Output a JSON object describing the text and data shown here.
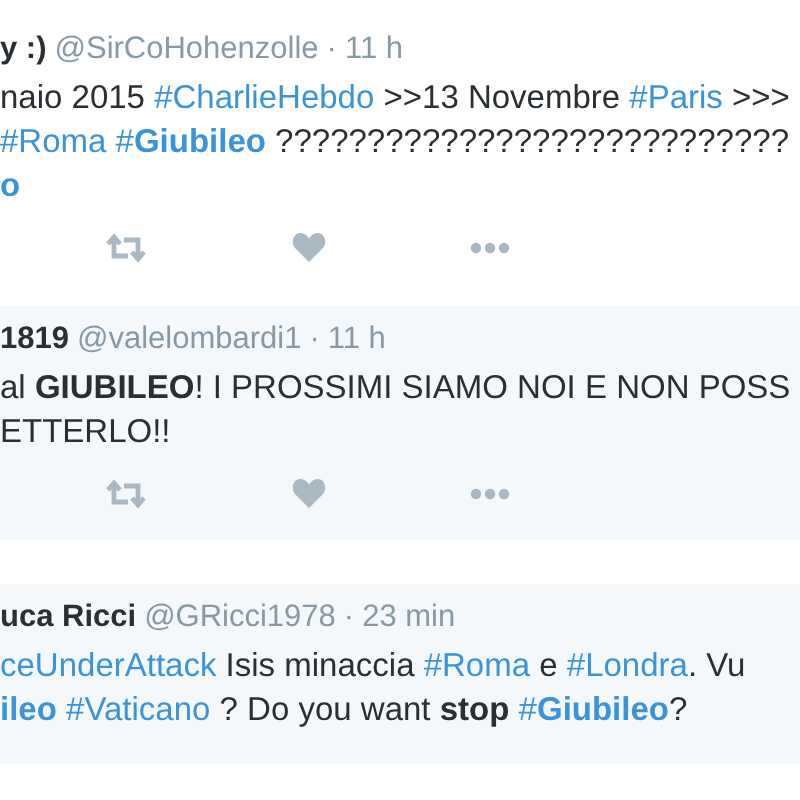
{
  "tweets": [
    {
      "name": "y :)",
      "handle": "@SirCoHohenzolle",
      "separator": "·",
      "time": "11 h",
      "highlighted": false,
      "lines": [
        [
          {
            "text": "naio 2015 ",
            "kind": "text"
          },
          {
            "text": "#CharlieHebdo",
            "kind": "hashtag"
          },
          {
            "text": " >>13 Novembre ",
            "kind": "text"
          },
          {
            "text": "#Paris",
            "kind": "hashtag"
          },
          {
            "text": " >>>",
            "kind": "text"
          }
        ],
        [
          {
            "text": "#Roma ",
            "kind": "hashtag"
          },
          {
            "text": "#**Giubileo**",
            "kind": "hashtag"
          },
          {
            "text": " ????????????????????????????",
            "kind": "text"
          }
        ],
        [
          {
            "text": "**o**",
            "kind": "hashtag"
          }
        ]
      ],
      "actions": true
    },
    {
      "name": "1819",
      "handle": "@valelombardi1",
      "separator": "·",
      "time": "11 h",
      "highlighted": true,
      "lines": [
        [
          {
            "text": "al **GIUBILEO**! I PROSSIMI SIAMO NOI E NON POSS",
            "kind": "text"
          }
        ],
        [
          {
            "text": "ETTERLO!!",
            "kind": "text"
          }
        ]
      ],
      "actions": true
    },
    {
      "name": "uca Ricci",
      "handle": "@GRicci1978",
      "separator": "·",
      "time": "23 min",
      "highlighted": true,
      "lines": [
        [
          {
            "text": "ceUnderAttack",
            "kind": "hashtag"
          },
          {
            "text": " Isis  minaccia ",
            "kind": "text"
          },
          {
            "text": "#Roma",
            "kind": "hashtag"
          },
          {
            "text": " e ",
            "kind": "text"
          },
          {
            "text": "#Londra",
            "kind": "hashtag"
          },
          {
            "text": ". Vu",
            "kind": "text"
          }
        ],
        [
          {
            "text": "**ileo** ",
            "kind": "hashtag"
          },
          {
            "text": "#Vaticano",
            "kind": "hashtag"
          },
          {
            "text": " ? Do you want **stop** ",
            "kind": "text"
          },
          {
            "text": "#**Giubileo**",
            "kind": "hashtag"
          },
          {
            "text": "?",
            "kind": "text"
          }
        ]
      ],
      "actions": false
    }
  ]
}
